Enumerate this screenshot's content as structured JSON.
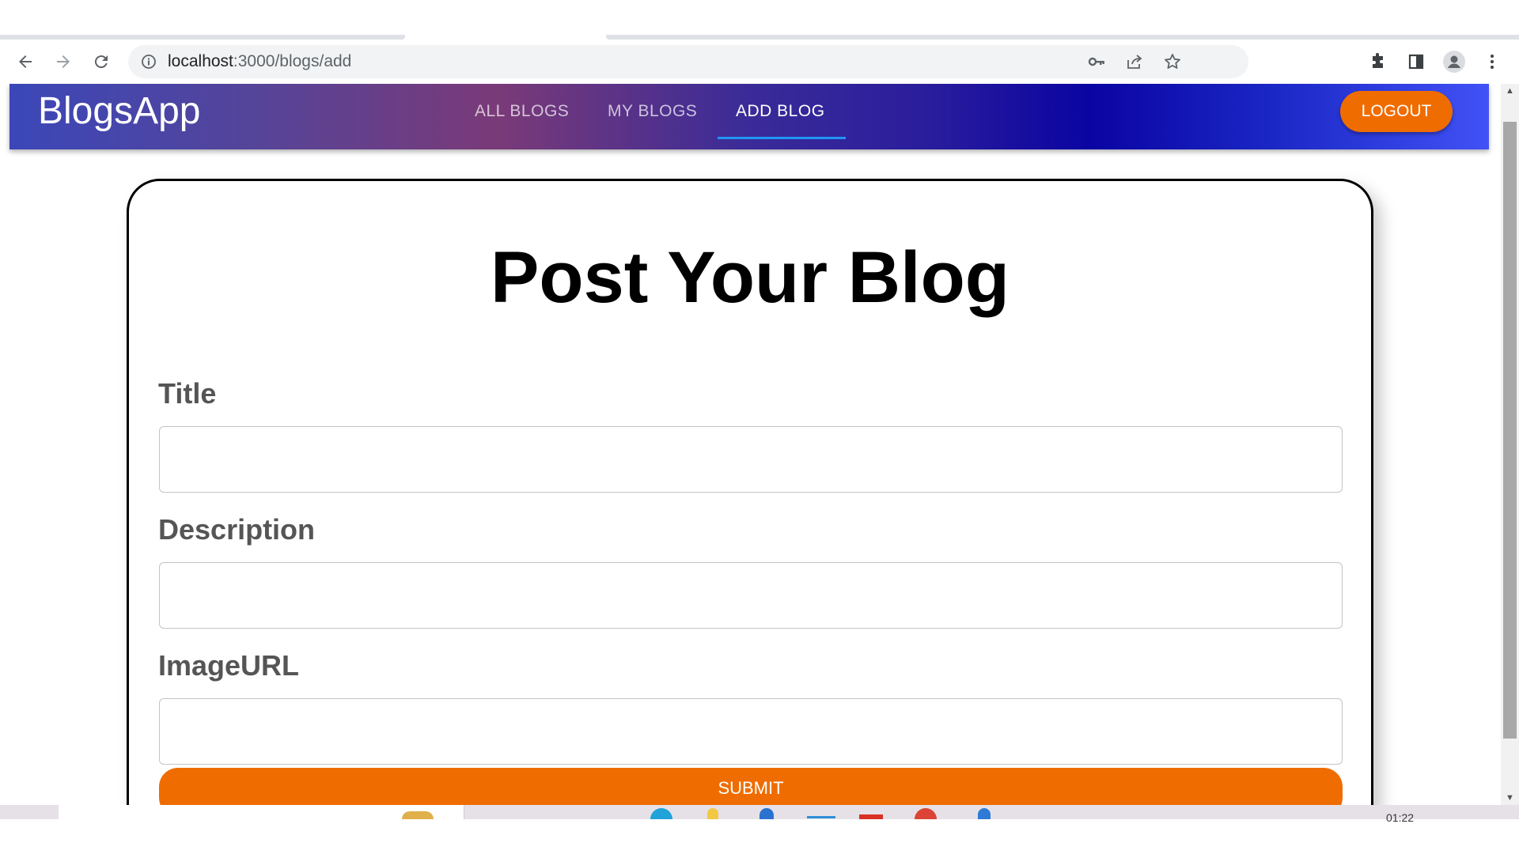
{
  "browser": {
    "url_host": "localhost",
    "url_path": ":3000/blogs/add"
  },
  "app": {
    "brand": "BlogsApp",
    "tabs": [
      {
        "label": "All Blogs",
        "active": false
      },
      {
        "label": "My Blogs",
        "active": false
      },
      {
        "label": "Add Blog",
        "active": true
      }
    ],
    "logout_label": "Logout",
    "colors": {
      "accent": "#ef6c00",
      "tab_indicator": "#2196f3"
    }
  },
  "form": {
    "heading": "Post Your Blog",
    "fields": [
      {
        "label": "Title",
        "value": ""
      },
      {
        "label": "Description",
        "value": ""
      },
      {
        "label": "ImageURL",
        "value": ""
      }
    ],
    "submit_label": "Submit"
  },
  "taskbar": {
    "clock": "01:22"
  }
}
